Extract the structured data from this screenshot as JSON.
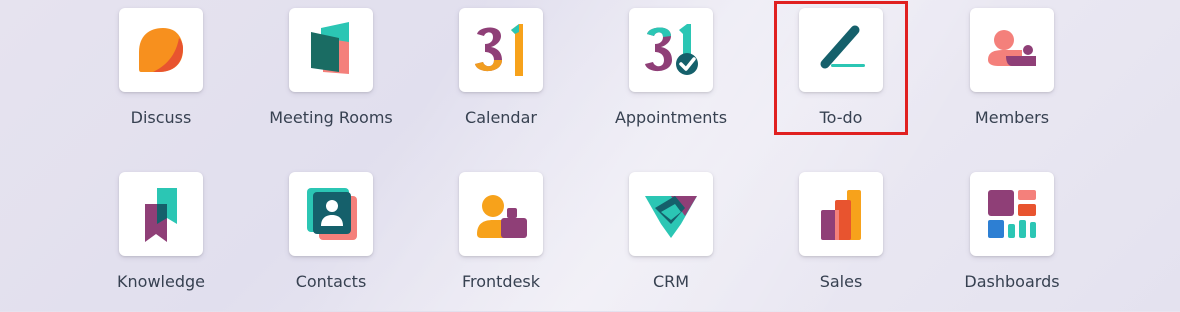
{
  "apps": [
    {
      "label": "Discuss",
      "icon": "discuss-icon"
    },
    {
      "label": "Meeting Rooms",
      "icon": "meeting-rooms-icon"
    },
    {
      "label": "Calendar",
      "icon": "calendar-icon",
      "icon_text": "31"
    },
    {
      "label": "Appointments",
      "icon": "appointments-icon",
      "icon_text": "31"
    },
    {
      "label": "To-do",
      "icon": "todo-icon"
    },
    {
      "label": "Members",
      "icon": "members-icon"
    },
    {
      "label": "Knowledge",
      "icon": "knowledge-icon"
    },
    {
      "label": "Contacts",
      "icon": "contacts-icon"
    },
    {
      "label": "Frontdesk",
      "icon": "frontdesk-icon"
    },
    {
      "label": "CRM",
      "icon": "crm-icon"
    },
    {
      "label": "Sales",
      "icon": "sales-icon"
    },
    {
      "label": "Dashboards",
      "icon": "dashboards-icon"
    }
  ],
  "highlighted_app": "To-do",
  "colors": {
    "highlight_border": "#e02020",
    "teal": "#1aa89a",
    "dark_teal": "#15606b",
    "orange": "#f7a21b",
    "plum": "#8f3f77",
    "coral": "#f4807b"
  }
}
